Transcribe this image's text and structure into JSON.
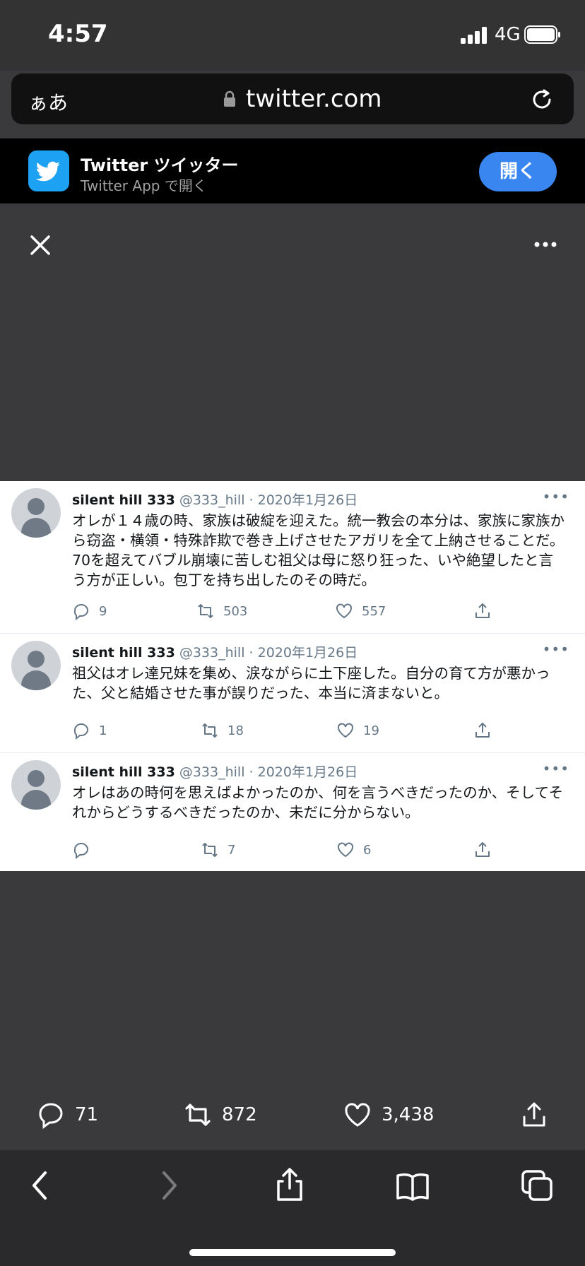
{
  "status": {
    "time": "4:57",
    "network": "4G"
  },
  "browser": {
    "text_size_label": "ぁあ",
    "domain": "twitter.com"
  },
  "banner": {
    "app_name": "Twitter ツイッター",
    "app_sub": "Twitter App で開く",
    "open_label": "開く"
  },
  "tweets": [
    {
      "name": "silent hill 333",
      "meta": "@333_hill · 2020年1月26日",
      "text": "オレが１４歳の時、家族は破綻を迎えた。統一教会の本分は、家族に家族から窃盗・横領・特殊詐欺で巻き上げさせたアガリを全て上納させることだ。70を超えてバブル崩壊に苦しむ祖父は母に怒り狂った、いや絶望したと言う方が正しい。包丁を持ち出したのその時だ。",
      "replies": "9",
      "retweets": "503",
      "likes": "557"
    },
    {
      "name": "silent hill 333",
      "meta": "@333_hill · 2020年1月26日",
      "text": "祖父はオレ達兄妹を集め、涙ながらに土下座した。自分の育て方が悪かった、父と結婚させた事が誤りだった、本当に済まないと。",
      "replies": "1",
      "retweets": "18",
      "likes": "19"
    },
    {
      "name": "silent hill 333",
      "meta": "@333_hill · 2020年1月26日",
      "text": "オレはあの時何を思えばよかったのか、何を言うべきだったのか、そしてそれからどうするべきだったのか、未だに分からない。",
      "replies": "",
      "retweets": "7",
      "likes": "6"
    }
  ],
  "stats": {
    "replies": "71",
    "retweets": "872",
    "likes": "3,438"
  },
  "colors": {
    "twitter_blue": "#1da1f2",
    "open_button": "#3a86f0",
    "overlay": "#3a3a3c"
  }
}
